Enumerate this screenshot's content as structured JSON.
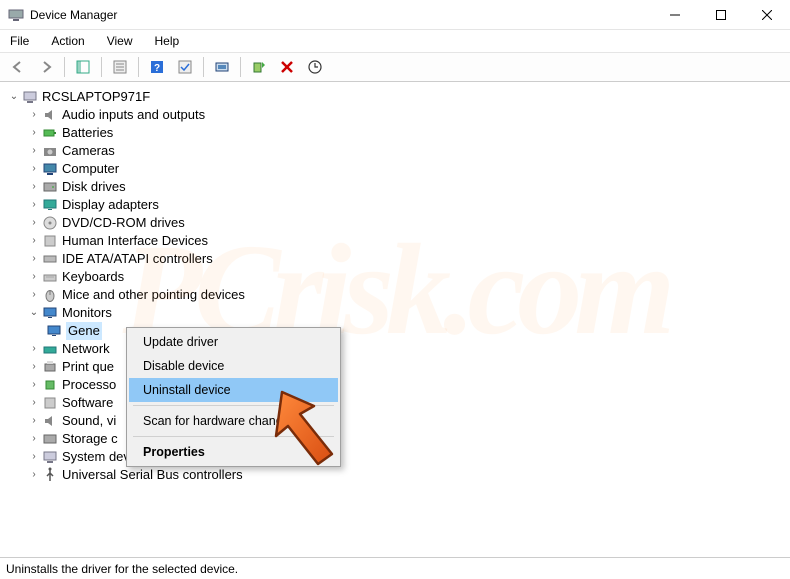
{
  "titlebar": {
    "title": "Device Manager"
  },
  "menubar": {
    "file": "File",
    "action": "Action",
    "view": "View",
    "help": "Help"
  },
  "tree": {
    "root": "RCSLAPTOP971F",
    "items": [
      "Audio inputs and outputs",
      "Batteries",
      "Cameras",
      "Computer",
      "Disk drives",
      "Display adapters",
      "DVD/CD-ROM drives",
      "Human Interface Devices",
      "IDE ATA/ATAPI controllers",
      "Keyboards",
      "Mice and other pointing devices",
      "Monitors",
      "Network",
      "Print que",
      "Processo",
      "Software",
      "Sound, vi",
      "Storage c",
      "System devices",
      "Universal Serial Bus controllers"
    ],
    "monitor_child": "Gene"
  },
  "context_menu": {
    "update": "Update driver",
    "disable": "Disable device",
    "uninstall": "Uninstall device",
    "scan": "Scan for hardware change",
    "properties": "Properties"
  },
  "statusbar": {
    "text": "Uninstalls the driver for the selected device."
  },
  "watermark": {
    "text": "PCrisk.com"
  }
}
